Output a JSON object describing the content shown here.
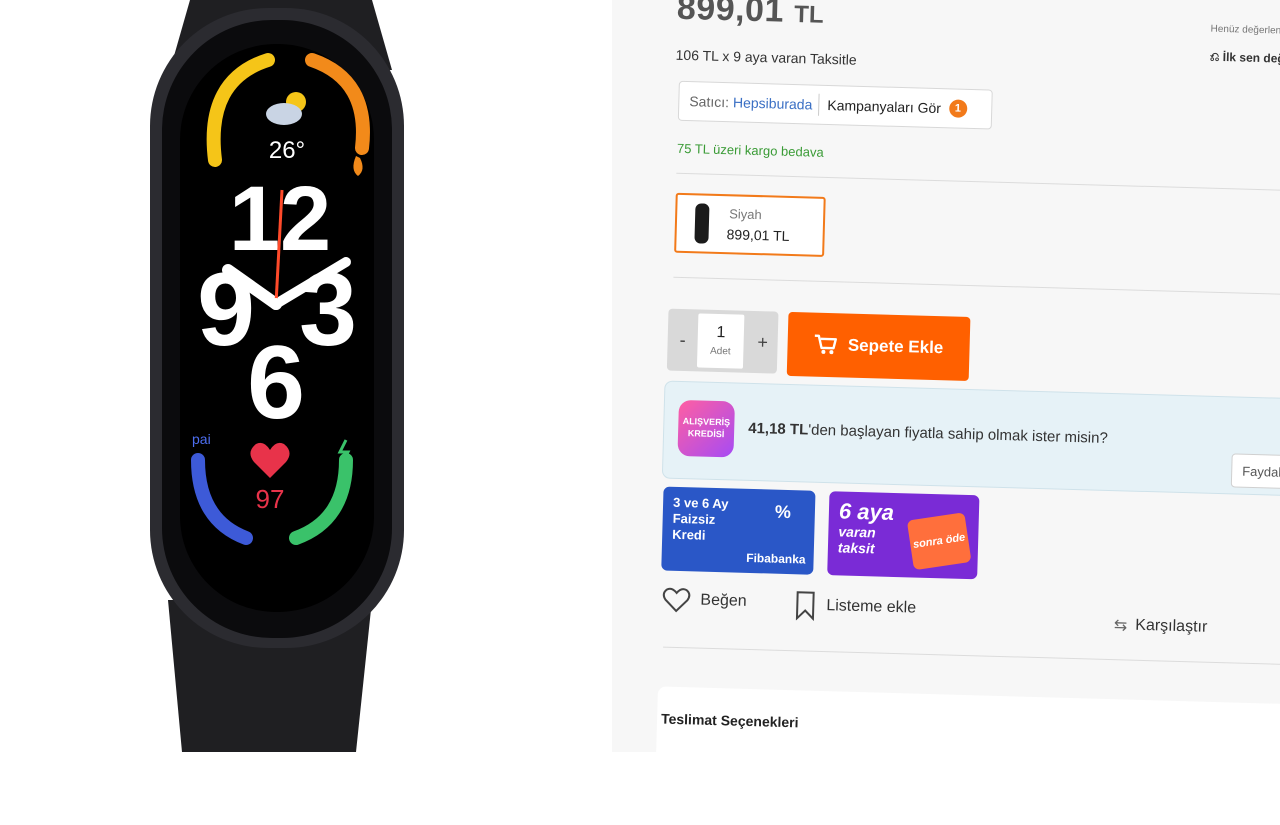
{
  "product": {
    "watch_time_hour": "12",
    "watch_digits": [
      "9",
      "3",
      "6"
    ],
    "watch_temp": "26°",
    "watch_pai_label": "pai",
    "watch_heart_rate": "97"
  },
  "price": {
    "amount": "899,01",
    "currency": "TL",
    "installment_text": "106 TL x 9 aya varan Taksitle"
  },
  "rating": {
    "note": "Henüz değerlendirilmedi",
    "first_review_label": "İlk sen değerlendir"
  },
  "seller": {
    "label": "Satıcı:",
    "name": "Hepsiburada",
    "campaign_link": "Kampanyaları Gör",
    "campaign_count": "1"
  },
  "shipping": {
    "note": "75 TL üzeri kargo bedava"
  },
  "variant": {
    "name": "Siyah",
    "price": "899,01 TL"
  },
  "quantity": {
    "value": "1",
    "unit": "Adet",
    "minus": "-",
    "plus": "+"
  },
  "cart": {
    "add_label": "Sepete Ekle"
  },
  "credit": {
    "badge_line1": "ALIŞVERİŞ",
    "badge_line2": "KREDİSİ",
    "amount": "41,18 TL",
    "text": "'den başlayan fiyatla sahip olmak ister misin?",
    "benefit_button": "Faydalan"
  },
  "promos": {
    "fiba": {
      "line1": "3 ve 6 Ay",
      "line2": "Faizsiz",
      "line3": "Kredi",
      "bank": "Fibabanka",
      "percent": "%"
    },
    "sonra": {
      "line1": "6 aya",
      "line2": "varan",
      "line3": "taksit",
      "tag": "sonra öde"
    }
  },
  "actions": {
    "like": "Beğen",
    "list": "Listeme ekle",
    "compare": "Karşılaştır"
  },
  "delivery": {
    "title": "Teslimat Seçenekleri"
  },
  "colors": {
    "accent_orange": "#ff6000",
    "seller_blue": "#3a6fc4",
    "free_shipping_green": "#3a9b36"
  }
}
